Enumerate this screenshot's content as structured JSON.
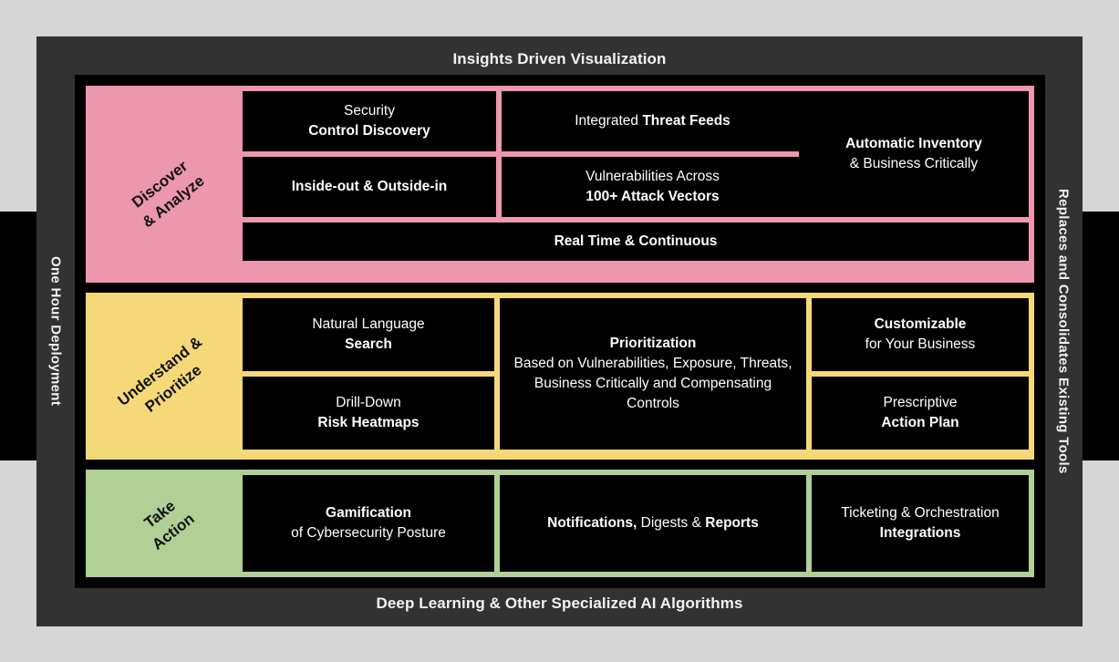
{
  "frame": {
    "title": "Insights Driven Visualization",
    "footer": "Deep Learning & Other Specialized AI Algorithms",
    "left_label": "One Hour Deployment",
    "right_label": "Replaces and Consolidates Existing Tools"
  },
  "colors": {
    "page_background": "#d6d6d6",
    "frame": "#323232",
    "panel": "#000000",
    "band_discover": "#ec97ad",
    "band_understand": "#f5d978",
    "band_action": "#b0d095",
    "tile_text": "#ffffff",
    "band_label_text": "#111111"
  },
  "bands": [
    {
      "id": "discover",
      "label_line1": "Discover",
      "label_line2": "& Analyze",
      "tiles": {
        "security_control_discovery": {
          "normal": "Security",
          "strong": "Control Discovery"
        },
        "integrated_threat_feeds": {
          "normal": "Integrated ",
          "strong": "Threat Feeds"
        },
        "inside_out_outside_in": {
          "strong": "Inside-out & Outside-in"
        },
        "vulnerabilities_attack_vectors": {
          "normal": "Vulnerabilities Across",
          "strong": "100+ Attack Vectors"
        },
        "automatic_inventory": {
          "strong": "Automatic Inventory",
          "normal": "& Business Critically"
        },
        "real_time_continuous": {
          "strong": "Real Time & Continuous"
        }
      }
    },
    {
      "id": "understand",
      "label_line1": "Understand &",
      "label_line2": "Prioritize",
      "tiles": {
        "natural_language_search": {
          "normal": "Natural Language",
          "strong": "Search"
        },
        "drill_down_risk_heatmaps": {
          "normal": "Drill-Down",
          "strong": "Risk Heatmaps"
        },
        "prioritization": {
          "strong": "Prioritization",
          "normal": "Based on Vulnerabilities, Exposure, Threats, Business Critically and Compensating Controls"
        },
        "customizable": {
          "strong": "Customizable",
          "normal": "for Your Business"
        },
        "prescriptive_action_plan": {
          "normal": "Prescriptive",
          "strong": "Action Plan"
        }
      }
    },
    {
      "id": "action",
      "label_line1": "Take",
      "label_line2": "Action",
      "tiles": {
        "gamification": {
          "strong": "Gamification",
          "normal": "of Cybersecurity Posture"
        },
        "notifications_digests_reports": {
          "strong1": "Notifications,",
          "normal": " Digests & ",
          "strong2": "Reports"
        },
        "ticketing_orchestration": {
          "normal": "Ticketing & Orchestration",
          "strong": "Integrations"
        }
      }
    }
  ]
}
